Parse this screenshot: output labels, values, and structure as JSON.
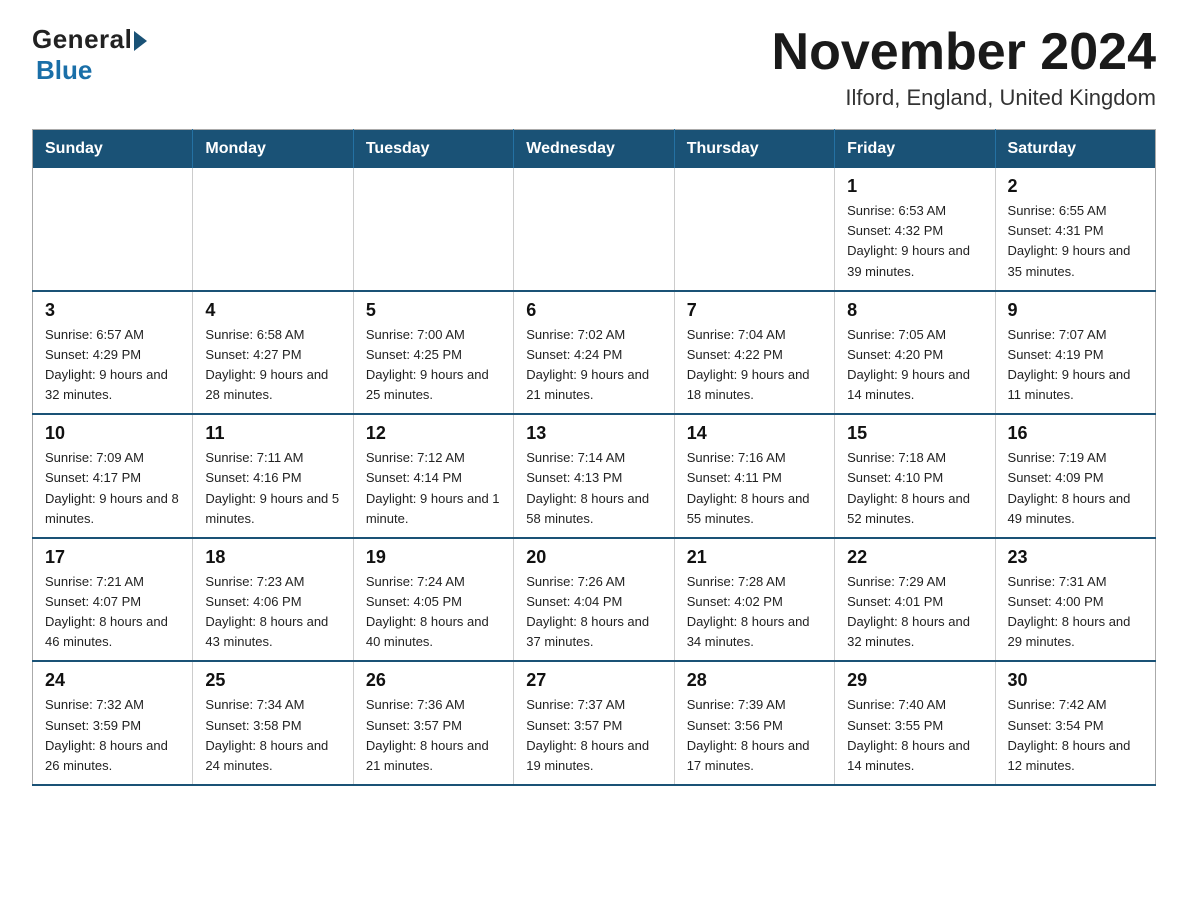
{
  "logo": {
    "general": "General",
    "blue": "Blue"
  },
  "title": "November 2024",
  "subtitle": "Ilford, England, United Kingdom",
  "weekdays": [
    "Sunday",
    "Monday",
    "Tuesday",
    "Wednesday",
    "Thursday",
    "Friday",
    "Saturday"
  ],
  "weeks": [
    [
      {
        "day": "",
        "info": ""
      },
      {
        "day": "",
        "info": ""
      },
      {
        "day": "",
        "info": ""
      },
      {
        "day": "",
        "info": ""
      },
      {
        "day": "",
        "info": ""
      },
      {
        "day": "1",
        "info": "Sunrise: 6:53 AM\nSunset: 4:32 PM\nDaylight: 9 hours\nand 39 minutes."
      },
      {
        "day": "2",
        "info": "Sunrise: 6:55 AM\nSunset: 4:31 PM\nDaylight: 9 hours\nand 35 minutes."
      }
    ],
    [
      {
        "day": "3",
        "info": "Sunrise: 6:57 AM\nSunset: 4:29 PM\nDaylight: 9 hours\nand 32 minutes."
      },
      {
        "day": "4",
        "info": "Sunrise: 6:58 AM\nSunset: 4:27 PM\nDaylight: 9 hours\nand 28 minutes."
      },
      {
        "day": "5",
        "info": "Sunrise: 7:00 AM\nSunset: 4:25 PM\nDaylight: 9 hours\nand 25 minutes."
      },
      {
        "day": "6",
        "info": "Sunrise: 7:02 AM\nSunset: 4:24 PM\nDaylight: 9 hours\nand 21 minutes."
      },
      {
        "day": "7",
        "info": "Sunrise: 7:04 AM\nSunset: 4:22 PM\nDaylight: 9 hours\nand 18 minutes."
      },
      {
        "day": "8",
        "info": "Sunrise: 7:05 AM\nSunset: 4:20 PM\nDaylight: 9 hours\nand 14 minutes."
      },
      {
        "day": "9",
        "info": "Sunrise: 7:07 AM\nSunset: 4:19 PM\nDaylight: 9 hours\nand 11 minutes."
      }
    ],
    [
      {
        "day": "10",
        "info": "Sunrise: 7:09 AM\nSunset: 4:17 PM\nDaylight: 9 hours\nand 8 minutes."
      },
      {
        "day": "11",
        "info": "Sunrise: 7:11 AM\nSunset: 4:16 PM\nDaylight: 9 hours\nand 5 minutes."
      },
      {
        "day": "12",
        "info": "Sunrise: 7:12 AM\nSunset: 4:14 PM\nDaylight: 9 hours\nand 1 minute."
      },
      {
        "day": "13",
        "info": "Sunrise: 7:14 AM\nSunset: 4:13 PM\nDaylight: 8 hours\nand 58 minutes."
      },
      {
        "day": "14",
        "info": "Sunrise: 7:16 AM\nSunset: 4:11 PM\nDaylight: 8 hours\nand 55 minutes."
      },
      {
        "day": "15",
        "info": "Sunrise: 7:18 AM\nSunset: 4:10 PM\nDaylight: 8 hours\nand 52 minutes."
      },
      {
        "day": "16",
        "info": "Sunrise: 7:19 AM\nSunset: 4:09 PM\nDaylight: 8 hours\nand 49 minutes."
      }
    ],
    [
      {
        "day": "17",
        "info": "Sunrise: 7:21 AM\nSunset: 4:07 PM\nDaylight: 8 hours\nand 46 minutes."
      },
      {
        "day": "18",
        "info": "Sunrise: 7:23 AM\nSunset: 4:06 PM\nDaylight: 8 hours\nand 43 minutes."
      },
      {
        "day": "19",
        "info": "Sunrise: 7:24 AM\nSunset: 4:05 PM\nDaylight: 8 hours\nand 40 minutes."
      },
      {
        "day": "20",
        "info": "Sunrise: 7:26 AM\nSunset: 4:04 PM\nDaylight: 8 hours\nand 37 minutes."
      },
      {
        "day": "21",
        "info": "Sunrise: 7:28 AM\nSunset: 4:02 PM\nDaylight: 8 hours\nand 34 minutes."
      },
      {
        "day": "22",
        "info": "Sunrise: 7:29 AM\nSunset: 4:01 PM\nDaylight: 8 hours\nand 32 minutes."
      },
      {
        "day": "23",
        "info": "Sunrise: 7:31 AM\nSunset: 4:00 PM\nDaylight: 8 hours\nand 29 minutes."
      }
    ],
    [
      {
        "day": "24",
        "info": "Sunrise: 7:32 AM\nSunset: 3:59 PM\nDaylight: 8 hours\nand 26 minutes."
      },
      {
        "day": "25",
        "info": "Sunrise: 7:34 AM\nSunset: 3:58 PM\nDaylight: 8 hours\nand 24 minutes."
      },
      {
        "day": "26",
        "info": "Sunrise: 7:36 AM\nSunset: 3:57 PM\nDaylight: 8 hours\nand 21 minutes."
      },
      {
        "day": "27",
        "info": "Sunrise: 7:37 AM\nSunset: 3:57 PM\nDaylight: 8 hours\nand 19 minutes."
      },
      {
        "day": "28",
        "info": "Sunrise: 7:39 AM\nSunset: 3:56 PM\nDaylight: 8 hours\nand 17 minutes."
      },
      {
        "day": "29",
        "info": "Sunrise: 7:40 AM\nSunset: 3:55 PM\nDaylight: 8 hours\nand 14 minutes."
      },
      {
        "day": "30",
        "info": "Sunrise: 7:42 AM\nSunset: 3:54 PM\nDaylight: 8 hours\nand 12 minutes."
      }
    ]
  ]
}
